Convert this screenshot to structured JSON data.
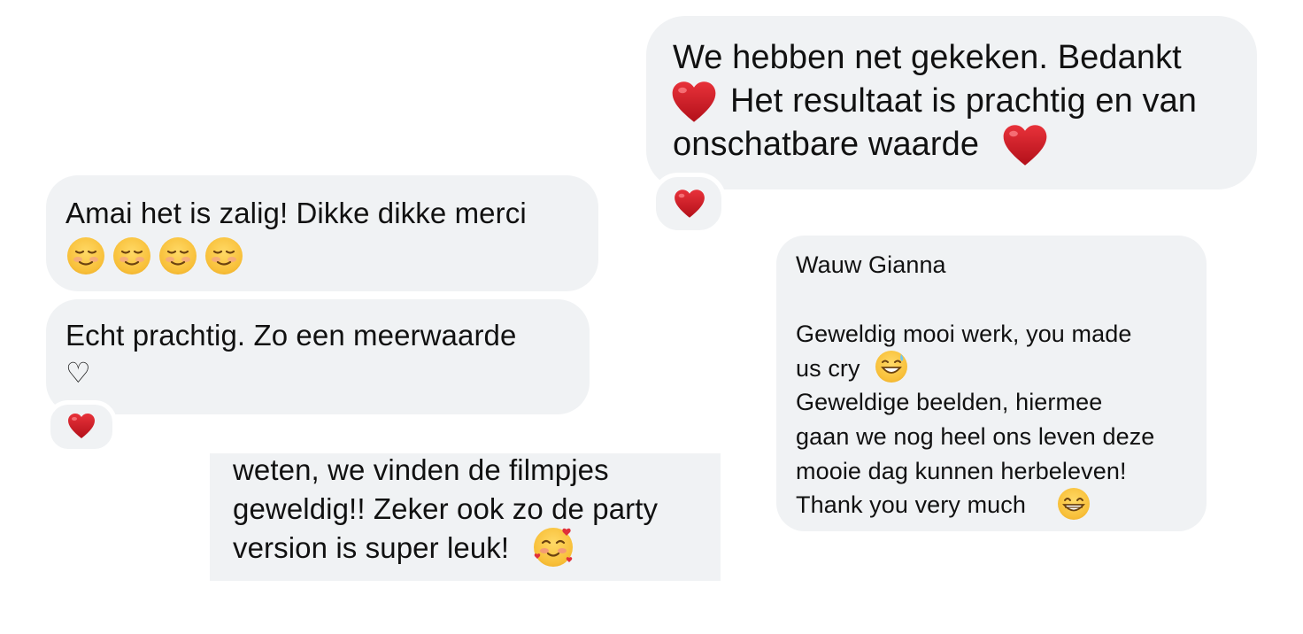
{
  "messages": {
    "top_right": {
      "line1": "We hebben net gekeken. Bedankt",
      "line2": "Het resultaat is prachtig en van",
      "line3": "onschatbare waarde",
      "reaction": "red-heart-emoji"
    },
    "left_1": {
      "line1": "Amai het is zalig! Dikke dikke merci",
      "emojis": [
        "smiling-face-emoji",
        "smiling-face-emoji",
        "smiling-face-emoji",
        "smiling-face-emoji"
      ]
    },
    "left_2": {
      "line1": "Echt prachtig. Zo een meerwaarde",
      "line2": "♡",
      "reaction": "red-heart-emoji"
    },
    "bottom_middle": {
      "line1": "weten, we vinden de filmpjes",
      "line2": "geweldig!! Zeker ook zo de party",
      "line3": "version is super leuk!",
      "emoji": "smiling-face-with-hearts-emoji"
    },
    "right_middle": {
      "line1": "Wauw Gianna",
      "line2": "Geweldig mooi werk, you made",
      "line3": "us cry",
      "line4": "Geweldige beelden, hiermee",
      "line5": "gaan we nog heel ons leven deze",
      "line6": "mooie dag kunnen herbeleven!",
      "line7": "Thank you very much",
      "emojis": [
        "grinning-face-with-sweat-emoji",
        "beaming-face-emoji"
      ]
    }
  }
}
